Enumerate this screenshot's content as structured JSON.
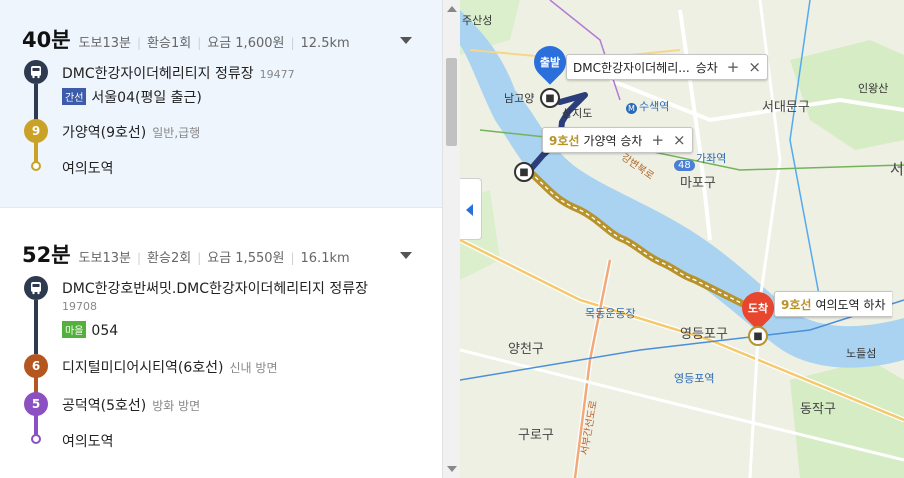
{
  "routes": [
    {
      "time": "40분",
      "walk": "도보13분",
      "transfer": "환승1회",
      "fare": "요금 1,600원",
      "distance": "12.5km",
      "steps": [
        {
          "icon": "bus",
          "color": "#2d3a4f",
          "name": "DMC한강자이더헤리티지 정류장",
          "code": "19477"
        },
        {
          "badge": "간선",
          "badge_color": "#3d5bab",
          "bus_no": "서울04(평일 출근)"
        },
        {
          "icon": "9",
          "color": "#c9a227",
          "name": "가양역(9호선)",
          "sub": "일반,급행"
        },
        {
          "icon": "dot",
          "color": "#c9a227",
          "name": "여의도역"
        }
      ]
    },
    {
      "time": "52분",
      "walk": "도보13분",
      "transfer": "환승2회",
      "fare": "요금 1,550원",
      "distance": "16.1km",
      "steps": [
        {
          "icon": "bus",
          "color": "#2d3a4f",
          "name": "DMC한강호반써밋.DMC한강자이더헤리티지 정류장",
          "code": "19708"
        },
        {
          "badge": "마을",
          "badge_color": "#52b13b",
          "bus_no": "054"
        },
        {
          "icon": "6",
          "color": "#b4561f",
          "name": "디지털미디어시티역(6호선)",
          "sub": "신내 방면"
        },
        {
          "icon": "5",
          "color": "#8b50c2",
          "name": "공덕역(5호선)",
          "sub": "방화 방면"
        },
        {
          "icon": "dot",
          "color": "#8b50c2",
          "name": "여의도역"
        }
      ]
    }
  ],
  "map": {
    "labels": {
      "l1": "주산성",
      "l2": "남고양",
      "l3": "수색역",
      "l4": "서대문구",
      "l5": "인왕산",
      "l6": "가좌역",
      "l7": "마포구",
      "l8": "서",
      "l9": "양천구",
      "l10": "영등포구",
      "l11": "노들섬",
      "l12": "동작구",
      "l13": "구로구",
      "l14": "상지도",
      "l15": "목동운동장",
      "l16": "영등포역",
      "road1": "강변북로",
      "road2": "서부간선도로",
      "badge48": "48"
    },
    "start_pin": "출발",
    "end_pin": "도착",
    "bubble_start": {
      "name": "DMC한강자이더헤리...",
      "action": "승차",
      "plus": "+",
      "close": "×"
    },
    "bubble_mid": {
      "line": "9호선",
      "name": "가양역 승차",
      "plus": "+",
      "close": "×"
    },
    "bubble_end": {
      "line": "9호선",
      "name": "여의도역 하차"
    },
    "colors": {
      "route_bus": "#2b3d7a",
      "route_line9": "#b8922a",
      "river": "#a9d3f0",
      "park": "#c9e5b5",
      "start": "#2a6fdb",
      "end": "#e8462f"
    }
  }
}
